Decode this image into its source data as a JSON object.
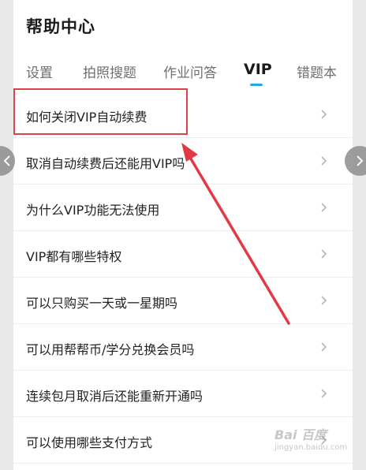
{
  "header": {
    "title": "帮助中心"
  },
  "tabs": [
    {
      "label": "设置",
      "active": false
    },
    {
      "label": "拍照搜题",
      "active": false
    },
    {
      "label": "作业问答",
      "active": false
    },
    {
      "label": "VIP",
      "active": true
    },
    {
      "label": "错题本",
      "active": false
    }
  ],
  "faq": {
    "items": [
      {
        "label": "如何关闭VIP自动续费"
      },
      {
        "label": "取消自动续费后还能用VIP吗"
      },
      {
        "label": "为什么VIP功能无法使用"
      },
      {
        "label": "VIP都有哪些特权"
      },
      {
        "label": "可以只购买一天或一星期吗"
      },
      {
        "label": "可以用帮帮币/学分兑换会员吗"
      },
      {
        "label": "连续包月取消后还能重新开通吗"
      },
      {
        "label": "可以使用哪些支付方式"
      }
    ]
  },
  "annotation": {
    "highlight_color": "#e0404a"
  },
  "colors": {
    "accent": "#21a9f0",
    "text_primary": "#1b1b1b",
    "text_secondary": "#6f6f6f"
  },
  "watermark": {
    "logo_text": "Bai 百度",
    "url": "jingyan.baidu.com"
  }
}
